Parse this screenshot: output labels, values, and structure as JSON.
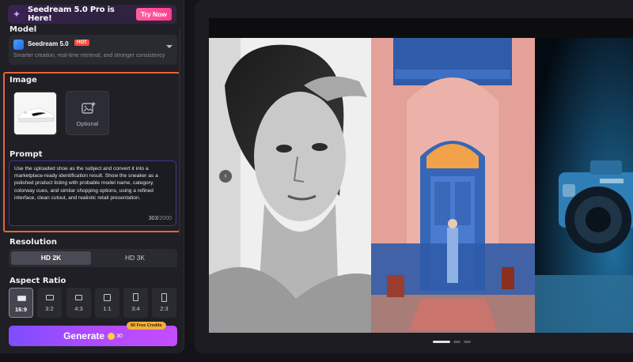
{
  "banner": {
    "text": "Seedream 5.0 Pro is Here!",
    "cta": "Try Now",
    "icon": "sparkle-icon"
  },
  "model": {
    "section_label": "Model",
    "name": "Seedream 5.0",
    "badge": "HOT",
    "description": "Smarter creation, real-time retrieval, and stronger consistency"
  },
  "image": {
    "section_label": "Image",
    "optional_label": "Optional"
  },
  "prompt": {
    "section_label": "Prompt",
    "text": "Use the uploaded shoe as the subject and convert it into a marketplace-ready identification result. Show the sneaker as a polished product listing with probable model name, category, colorway cues, and similar shopping options, using a refined interface, clean cutout, and realistic retail presentation.",
    "count": "303",
    "max": "/2000"
  },
  "resolution": {
    "section_label": "Resolution",
    "options": [
      "HD 2K",
      "HD 3K"
    ],
    "selected": "HD 2K"
  },
  "aspect_ratio": {
    "section_label": "Aspect Ratio",
    "options": [
      "16:9",
      "3:2",
      "4:3",
      "1:1",
      "3:4",
      "2:3"
    ],
    "selected": "16:9"
  },
  "generate": {
    "label": "Generate",
    "cost": "30",
    "credits_badge": "60 Free Credits"
  },
  "carousel": {
    "slide_count": 3,
    "active_index": 0
  },
  "colors": {
    "accent": "#9b4dff",
    "highlight_border": "#e8643a",
    "hot": "#ff4d3a",
    "try_now": "#ff3e8d"
  }
}
